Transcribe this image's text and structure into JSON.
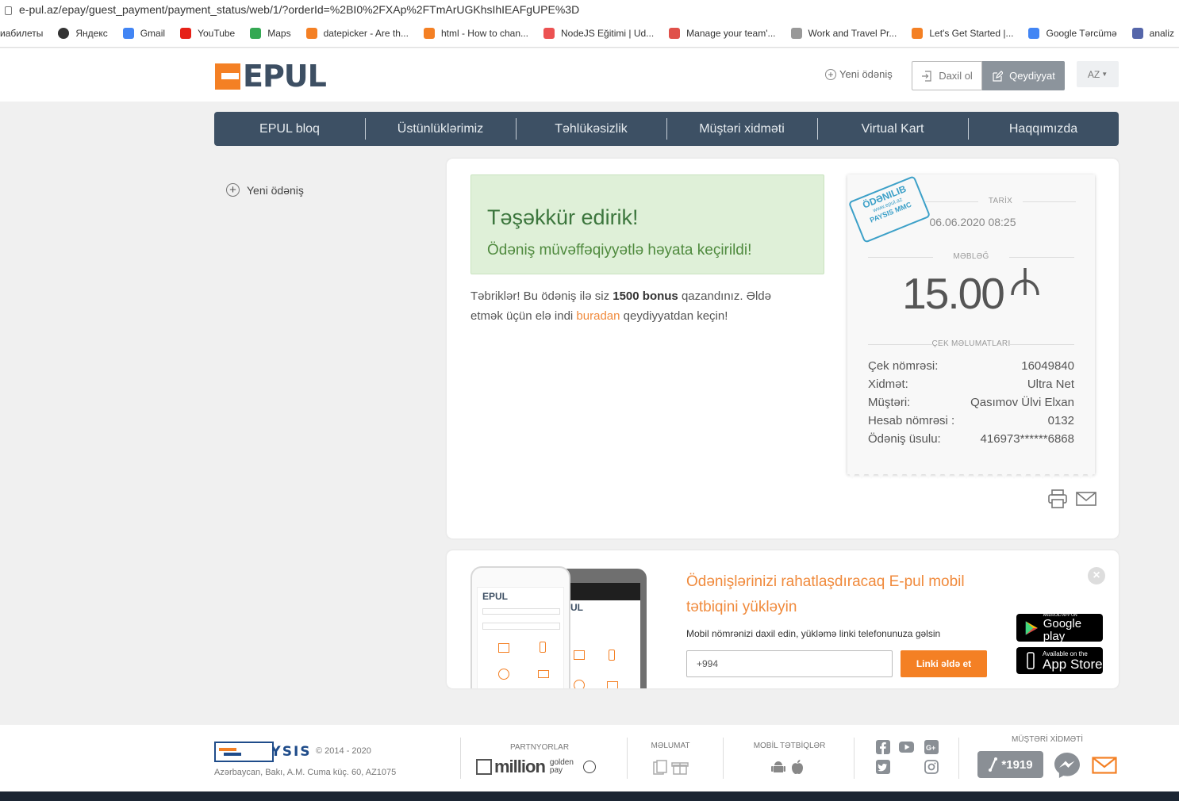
{
  "browser": {
    "url": "e-pul.az/epay/guest_payment/payment_status/web/1/?orderId=%2BI0%2FXAp%2FTmArUGKhsIhIEAFgUPE%3D",
    "bookmarks": [
      {
        "label": "иабилеты",
        "color": ""
      },
      {
        "label": "Яндекс",
        "color": "#333333"
      },
      {
        "label": "Gmail",
        "color": "#4285f4"
      },
      {
        "label": "YouTube",
        "color": "#e62117"
      },
      {
        "label": "Maps",
        "color": "#34a853"
      },
      {
        "label": "datepicker - Are th...",
        "color": "#f48024"
      },
      {
        "label": "html - How to chan...",
        "color": "#f48024"
      },
      {
        "label": "NodeJS Eğitimi | Ud...",
        "color": "#ec5252"
      },
      {
        "label": "Manage your team'...",
        "color": "#e0514a"
      },
      {
        "label": "Work and Travel Pr...",
        "color": "#999999"
      },
      {
        "label": "Let's Get Started |...",
        "color": "#f48024"
      },
      {
        "label": "Google Tərcümə",
        "color": "#4285f4"
      },
      {
        "label": "analiz",
        "color": "#5566aa"
      }
    ]
  },
  "header": {
    "logo": "EPUL",
    "new_payment": "Yeni ödəniş",
    "login": "Daxil ol",
    "register": "Qeydiyyat",
    "lang": "AZ"
  },
  "nav": [
    "EPUL bloq",
    "Üstünlüklərimiz",
    "Təhlükəsizlik",
    "Müştəri xidməti",
    "Virtual Kart",
    "Haqqımızda"
  ],
  "sidebar": {
    "new_payment": "Yeni ödəniş"
  },
  "success": {
    "title": "Təşəkkür edirik!",
    "subtitle": "Ödəniş müvəffəqiyyətlə həyata keçirildi!",
    "msg_1": "Təbriklər! Bu ödəniş ilə siz ",
    "msg_bonus": "1500 bonus",
    "msg_2": " qazandınız. Əldə etmək üçün elə indi ",
    "msg_link": "buradan",
    "msg_3": " qeydiyyatdan keçin!"
  },
  "receipt": {
    "stamp_top": "ÖDƏNILIB",
    "stamp_mid": "www.epul.az",
    "stamp_bottom": "PAYSIS MMC",
    "date_label": "TARİX",
    "date": "06.06.2020 08:25",
    "amount_label": "MƏBLƏĞ",
    "amount": "15.00",
    "details_label": "ÇEK MƏLUMATLARI",
    "rows": [
      {
        "label": "Çek nömrəsi:",
        "value": "16049840"
      },
      {
        "label": "Xidmət:",
        "value": "Ultra Net"
      },
      {
        "label": "Müştəri:",
        "value": "Qasımov Ülvi Elxan"
      },
      {
        "label": "Hesab nömrəsi :",
        "value": "0132"
      },
      {
        "label": "Ödəniş üsulu:",
        "value": "416973******6868"
      }
    ]
  },
  "app_promo": {
    "title": "Ödənişlərinizi rahatlaşdıracaq E-pul mobil tətbiqini yükləyin",
    "subtitle": "Mobil nömrənizi daxil edin, yükləmə linki telefonunuza gəlsin",
    "phone_value": "+994",
    "send_label": "Linki əldə et",
    "google_small": "ANDROID APP ON",
    "google_big": "Google play",
    "apple_small": "Available on the",
    "apple_big": "App Store",
    "phone_logo": "EPUL",
    "phone_logo_2": "UL"
  },
  "footer": {
    "brand": "PAYSIS",
    "copyright": "© 2014 - 2020",
    "address": "Azərbaycan, Bakı, A.M. Cuma küç. 60, AZ1075",
    "partners_label": "PARTNYORLAR",
    "partner_1": "million",
    "partner_2": "golden pay",
    "info_label": "MƏLUMAT",
    "apps_label": "MOBİL TƏTBİQLƏR",
    "support_label": "MÜŞTƏRİ XİDMƏTİ",
    "phone": "*1919"
  }
}
